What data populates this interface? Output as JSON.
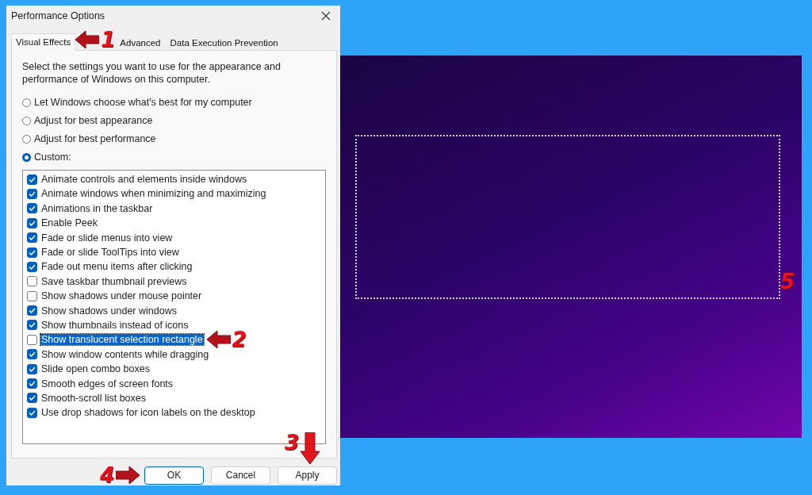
{
  "window": {
    "title": "Performance Options"
  },
  "tabs": [
    {
      "label": "Visual Effects",
      "selected": true,
      "marker": {
        "number": "1",
        "kind": "left"
      }
    },
    {
      "label": "Advanced",
      "selected": false
    },
    {
      "label": "Data Execution Prevention",
      "selected": false
    }
  ],
  "description": "Select the settings you want to use for the appearance and performance of Windows on this computer.",
  "radio_options": [
    {
      "label": "Let Windows choose what's best for my computer",
      "selected": false
    },
    {
      "label": "Adjust for best appearance",
      "selected": false
    },
    {
      "label": "Adjust for best performance",
      "selected": false
    },
    {
      "label": "Custom:",
      "selected": true
    }
  ],
  "effects": [
    {
      "label": "Animate controls and elements inside windows",
      "checked": true,
      "selected": false
    },
    {
      "label": "Animate windows when minimizing and maximizing",
      "checked": true,
      "selected": false
    },
    {
      "label": "Animations in the taskbar",
      "checked": true,
      "selected": false
    },
    {
      "label": "Enable Peek",
      "checked": true,
      "selected": false
    },
    {
      "label": "Fade or slide menus into view",
      "checked": true,
      "selected": false
    },
    {
      "label": "Fade or slide ToolTips into view",
      "checked": true,
      "selected": false
    },
    {
      "label": "Fade out menu items after clicking",
      "checked": true,
      "selected": false
    },
    {
      "label": "Save taskbar thumbnail previews",
      "checked": false,
      "selected": false
    },
    {
      "label": "Show shadows under mouse pointer",
      "checked": false,
      "selected": false
    },
    {
      "label": "Show shadows under windows",
      "checked": true,
      "selected": false
    },
    {
      "label": "Show thumbnails instead of icons",
      "checked": true,
      "selected": false
    },
    {
      "label": "Show translucent selection rectangle",
      "checked": false,
      "selected": true,
      "marker": {
        "number": "2",
        "kind": "left"
      }
    },
    {
      "label": "Show window contents while dragging",
      "checked": true,
      "selected": false
    },
    {
      "label": "Slide open combo boxes",
      "checked": true,
      "selected": false
    },
    {
      "label": "Smooth edges of screen fonts",
      "checked": true,
      "selected": false
    },
    {
      "label": "Smooth-scroll list boxes",
      "checked": true,
      "selected": false
    },
    {
      "label": "Use drop shadows for icon labels on the desktop",
      "checked": true,
      "selected": false
    }
  ],
  "buttons": [
    {
      "label": "OK",
      "default": true,
      "marker": {
        "number": "4",
        "kind": "right"
      }
    },
    {
      "label": "Cancel",
      "default": false
    },
    {
      "label": "Apply",
      "default": false,
      "marker": {
        "number": "3",
        "kind": "down"
      }
    }
  ],
  "desktop": {
    "selection_rectangle": true,
    "marker": {
      "number": "5"
    }
  }
}
